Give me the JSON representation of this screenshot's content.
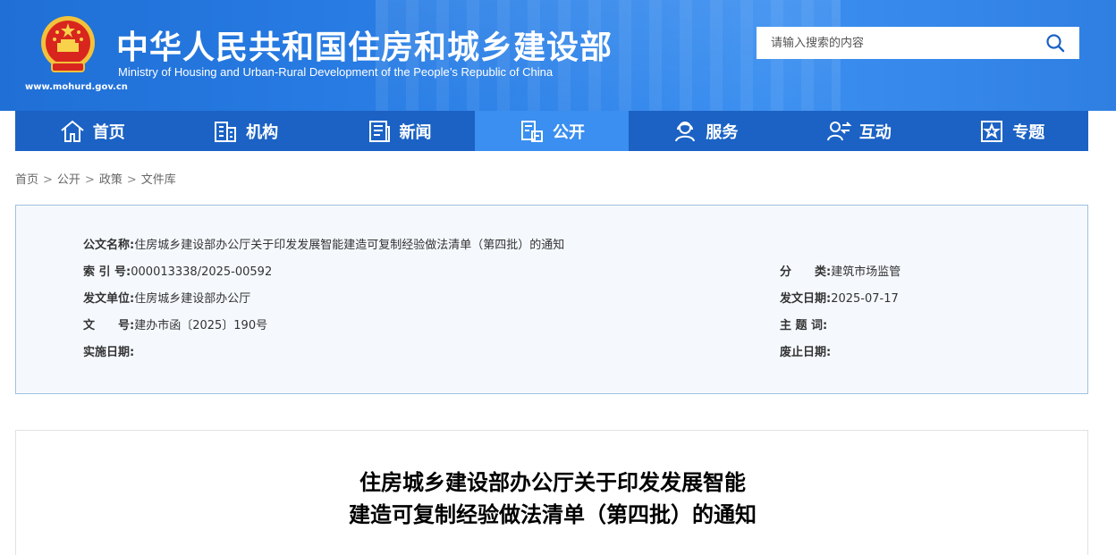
{
  "header": {
    "site_url": "www.mohurd.gov.cn",
    "title_cn": "中华人民共和国住房和城乡建设部",
    "title_en": "Ministry of Housing and Urban-Rural Development of the People’s Republic of China",
    "search_placeholder": "请输入搜索的内容"
  },
  "nav": {
    "items": [
      {
        "label": "首页",
        "icon": "home-icon"
      },
      {
        "label": "机构",
        "icon": "building-icon"
      },
      {
        "label": "新闻",
        "icon": "news-icon"
      },
      {
        "label": "公开",
        "icon": "document-icon",
        "active": true
      },
      {
        "label": "服务",
        "icon": "service-icon"
      },
      {
        "label": "互动",
        "icon": "interaction-icon"
      },
      {
        "label": "专题",
        "icon": "star-icon"
      }
    ]
  },
  "breadcrumb": [
    "首页",
    "公开",
    "政策",
    "文件库"
  ],
  "info": {
    "name_label": "公文名称:",
    "name_value": "住房城乡建设部办公厅关于印发发展智能建造可复制经验做法清单（第四批）的通知",
    "index_label": "索  引  号:",
    "index_value": "000013338/2025-00592",
    "category_label": "分　　类:",
    "category_value": "建筑市场监管",
    "issuer_label": "发文单位:",
    "issuer_value": "住房城乡建设部办公厅",
    "date_label": "发文日期:",
    "date_value": "2025-07-17",
    "docno_label": "文　　号:",
    "docno_value": "建办市函〔2025〕190号",
    "keywords_label": "主  题  词:",
    "keywords_value": "",
    "effective_label": "实施日期:",
    "effective_value": "",
    "expiry_label": "废止日期:",
    "expiry_value": ""
  },
  "document": {
    "title_line1": "住房城乡建设部办公厅关于印发发展智能",
    "title_line2": "建造可复制经验做法清单（第四批）的通知"
  },
  "colors": {
    "header_blue": "#2a7fe6",
    "nav_blue": "#1b62c4",
    "nav_active": "#3a8ff0",
    "info_bg": "#f5f9fd",
    "info_border": "#9fc1de"
  }
}
